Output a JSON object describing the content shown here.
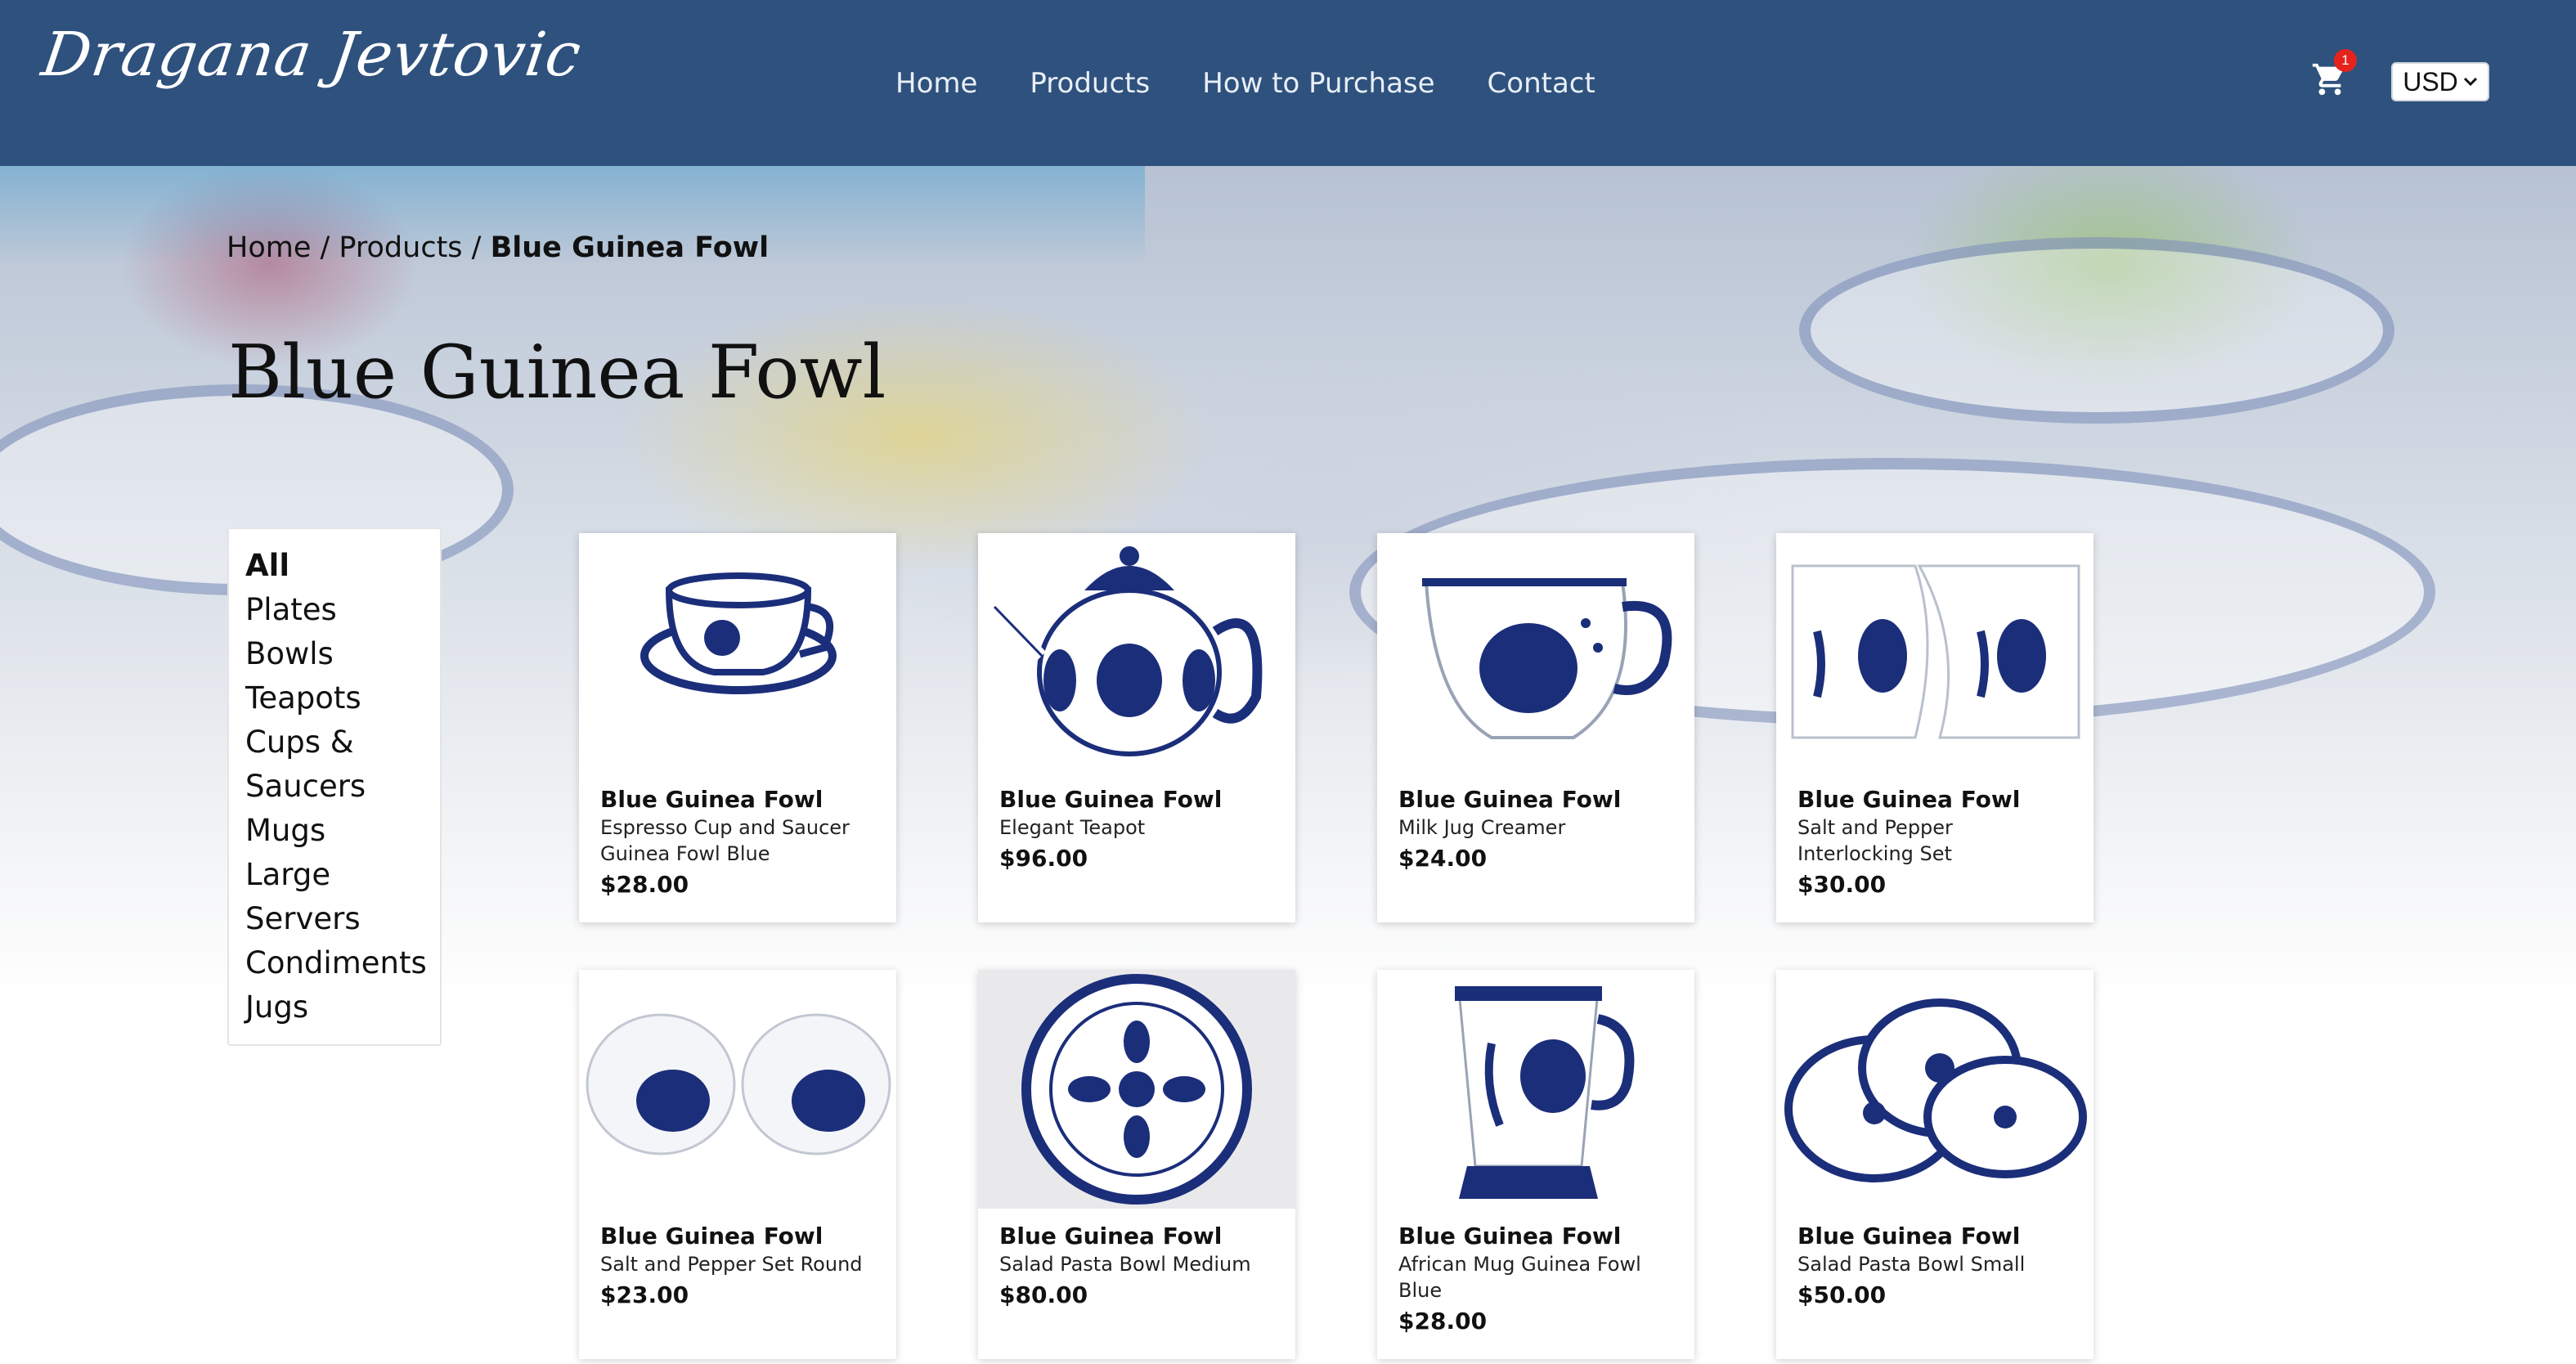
{
  "header": {
    "logo_text": "Dragana Jevtovic",
    "nav": [
      "Home",
      "Products",
      "How to Purchase",
      "Contact"
    ],
    "cart_count": "1",
    "currency": "USD",
    "colors": {
      "bar": "#2e517d",
      "badge": "#e5231d"
    }
  },
  "breadcrumb": {
    "home": "Home",
    "sep1": " / ",
    "products": "Products",
    "sep2": " / ",
    "current": "Blue Guinea Fowl"
  },
  "page_title": "Blue Guinea Fowl",
  "sidebar": {
    "items": [
      "All",
      "Plates",
      "Bowls",
      "Teapots",
      "Cups &",
      "Saucers",
      "Mugs",
      "Large",
      "Servers",
      "Condiments",
      "Jugs"
    ],
    "active": "All"
  },
  "products": [
    {
      "name": "Blue Guinea Fowl",
      "desc1": "Espresso Cup and Saucer",
      "desc2": "Guinea Fowl Blue",
      "price": "$28.00",
      "icon": "cup-saucer-icon"
    },
    {
      "name": "Blue Guinea Fowl",
      "desc1": "Elegant Teapot",
      "desc2": "",
      "price": "$96.00",
      "icon": "teapot-icon"
    },
    {
      "name": "Blue Guinea Fowl",
      "desc1": "Milk Jug Creamer",
      "desc2": "",
      "price": "$24.00",
      "icon": "milk-jug-icon"
    },
    {
      "name": "Blue Guinea Fowl",
      "desc1": "Salt and Pepper",
      "desc2": "Interlocking Set",
      "price": "$30.00",
      "icon": "salt-pepper-interlocking-icon"
    },
    {
      "name": "Blue Guinea Fowl",
      "desc1": "Salt and Pepper Set Round",
      "desc2": "",
      "price": "$23.00",
      "icon": "salt-pepper-round-icon"
    },
    {
      "name": "Blue Guinea Fowl",
      "desc1": "Salad Pasta Bowl Medium",
      "desc2": "",
      "price": "$80.00",
      "icon": "bowl-medium-icon"
    },
    {
      "name": "Blue Guinea Fowl",
      "desc1": "African Mug Guinea Fowl",
      "desc2": "Blue",
      "price": "$28.00",
      "icon": "mug-icon"
    },
    {
      "name": "Blue Guinea Fowl",
      "desc1": "Salad Pasta Bowl Small",
      "desc2": "",
      "price": "$50.00",
      "icon": "bowls-small-icon"
    }
  ]
}
